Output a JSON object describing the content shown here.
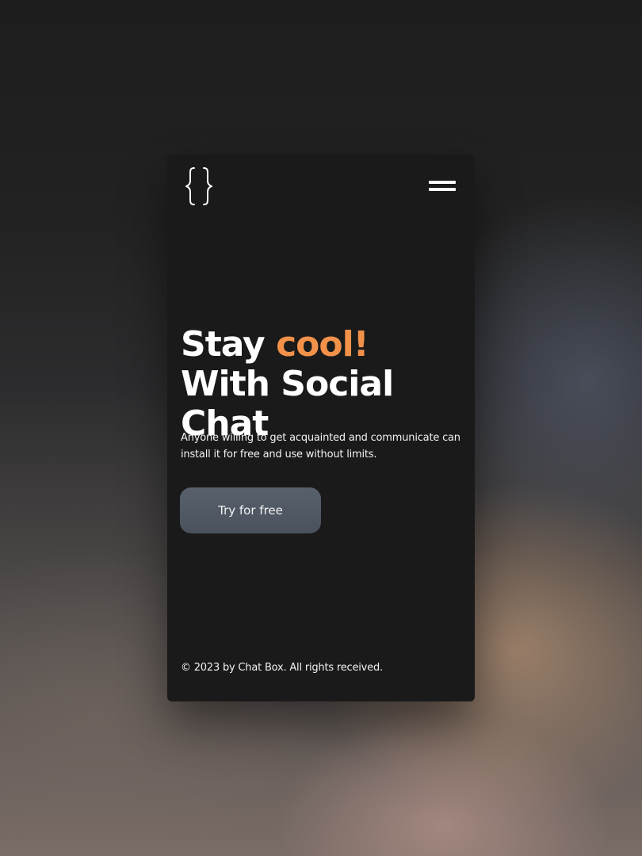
{
  "header": {
    "logo_icon": "curly-braces-icon",
    "menu_icon": "hamburger-menu-icon"
  },
  "hero": {
    "title_part1": "Stay ",
    "title_accent": "cool!",
    "title_part2": " With Social Chat",
    "subtitle": "Anyone willing to get acquainted and communicate can install it for free and use without limits.",
    "cta_label": "Try for free"
  },
  "footer": {
    "copyright": "© 2023 by Chat Box. All rights received."
  },
  "colors": {
    "accent": "#f2914a",
    "card_background": "#1a1a1a",
    "button_background": "#525a65",
    "text": "#ffffff"
  }
}
